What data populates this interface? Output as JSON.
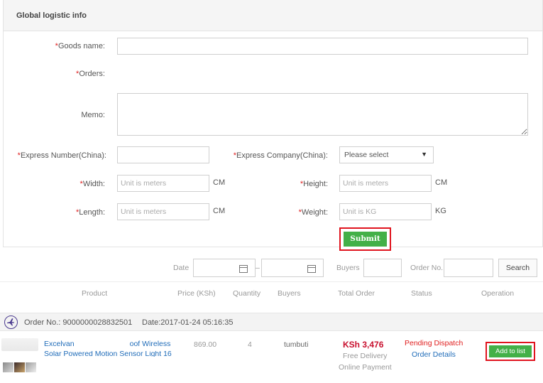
{
  "panel": {
    "title": "Global logistic info",
    "required_mark": "*"
  },
  "form": {
    "goods_name_label": "Goods name:",
    "orders_label": "Orders:",
    "memo_label": "Memo:",
    "express_number_label": "Express Number(China):",
    "express_company_label": "Express Company(China):",
    "express_company_value": "Please select",
    "width_label": "Width:",
    "width_placeholder": "Unit is meters",
    "width_unit": "CM",
    "height_label": "Height:",
    "height_placeholder": "Unit is meters",
    "height_unit": "CM",
    "length_label": "Length:",
    "length_placeholder": "Unit is meters",
    "length_unit": "CM",
    "weight_label": "Weight:",
    "weight_placeholder": "Unit is KG",
    "weight_unit": "KG",
    "submit_label": "Submit"
  },
  "filter": {
    "date_label": "Date",
    "date_sep": "–",
    "buyers_label": "Buyers",
    "order_no_label": "Order No.",
    "search_label": "Search"
  },
  "table_headers": {
    "product": "Product",
    "price": "Price (KSh)",
    "quantity": "Quantity",
    "buyers": "Buyers",
    "total": "Total Order",
    "status": "Status",
    "operation": "Operation"
  },
  "order": {
    "order_no": "Order No.: 9000000028832501",
    "date": "Date:2017-01-24 05:16:35",
    "product_line1": "Excelvan",
    "product_line1_tail": "oof Wireless",
    "product_line2": "Solar Powered Motion Sensor Light 16",
    "price": "869.00",
    "quantity": "4",
    "buyer": "tumbuti",
    "total": "KSh 3,476",
    "delivery": "Free Delivery",
    "payment": "Online Payment",
    "status": "Pending Dispatch",
    "details_link": "Order Details",
    "add_label": "Add to list"
  },
  "colors": {
    "accent_green": "#43b048",
    "highlight_red": "#e0141e",
    "link_blue": "#1e6bb8",
    "price_red": "#c8102e"
  }
}
